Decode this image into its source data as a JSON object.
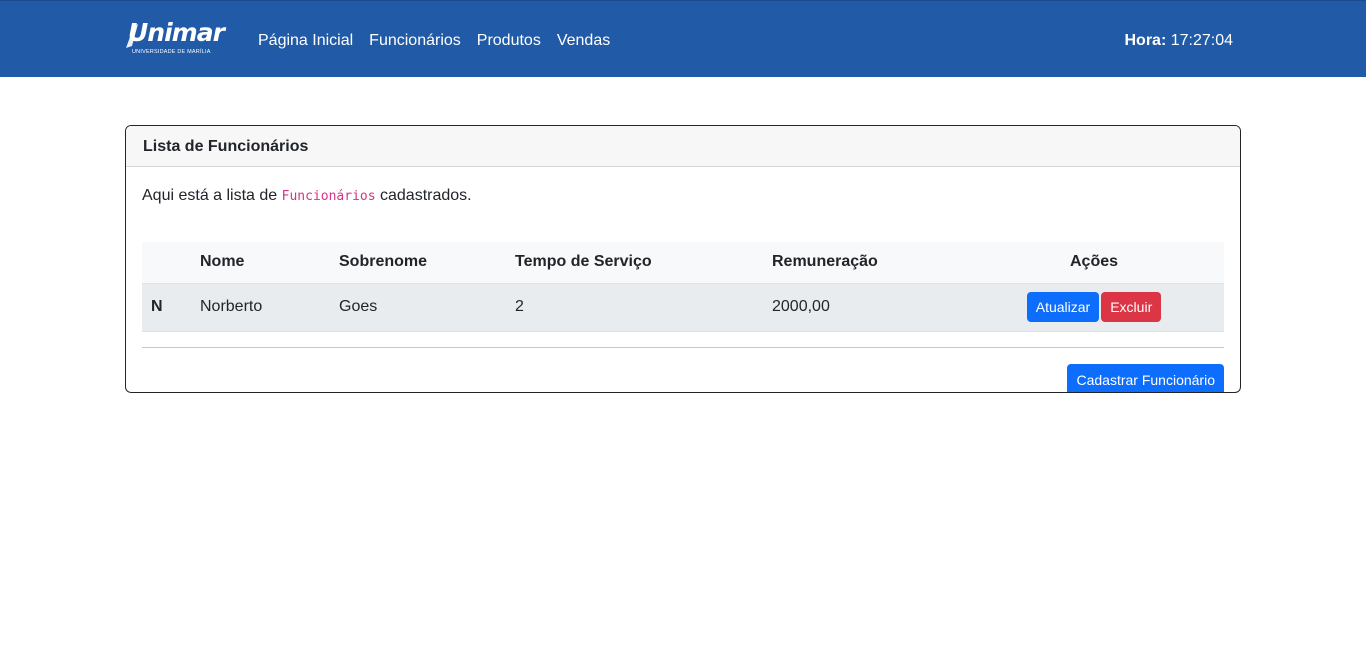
{
  "brand": {
    "name": "Unimar",
    "subtitle": "UNIVERSIDADE DE MARÍLIA"
  },
  "nav": {
    "items": [
      {
        "label": "Página Inicial"
      },
      {
        "label": "Funcionários"
      },
      {
        "label": "Produtos"
      },
      {
        "label": "Vendas"
      }
    ]
  },
  "clock": {
    "label": "Hora:",
    "time": "17:27:04"
  },
  "card": {
    "title": "Lista de Funcionários",
    "intro_prefix": "Aqui está a lista de ",
    "intro_code": "Funcionários",
    "intro_suffix": " cadastrados."
  },
  "table": {
    "headers": [
      "",
      "Nome",
      "Sobrenome",
      "Tempo de Serviço",
      "Remuneração",
      "Ações"
    ],
    "rows": [
      {
        "id": "N",
        "nome": "Norberto",
        "sobrenome": "Goes",
        "tempo": "2",
        "remuneracao": "2000,00",
        "update_label": "Atualizar",
        "delete_label": "Excluir"
      }
    ]
  },
  "actions": {
    "register_label": "Cadastrar Funcionário"
  },
  "colors": {
    "navbar": "#215aa6",
    "primary": "#0d6efd",
    "danger": "#dc3545",
    "code": "#d63384"
  }
}
